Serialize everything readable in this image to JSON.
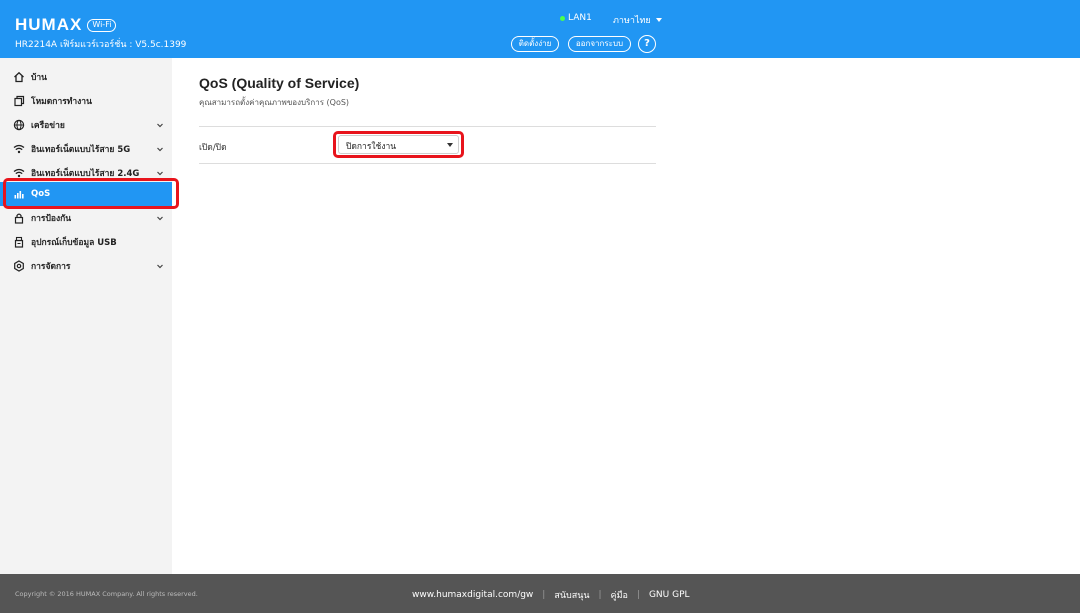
{
  "header": {
    "brand": "HUMAX",
    "brand_badge": "Wi-Fi",
    "firmware": "HR2214A เฟิร์มแวร์เวอร์ชั่น : V5.5c.1399",
    "lan_label": "LAN1",
    "language": "ภาษาไทย",
    "setup_button": "ติดตั้งง่าย",
    "logout_button": "ออกจากระบบ",
    "help_button": "?"
  },
  "sidebar": {
    "items": [
      {
        "label": "บ้าน",
        "icon": "home-icon"
      },
      {
        "label": "โหมดการทำงาน",
        "icon": "mode-icon"
      },
      {
        "label": "เครือข่าย",
        "icon": "globe-icon"
      },
      {
        "label": "อินเทอร์เน็ตแบบไร้สาย 5G",
        "icon": "wifi-icon"
      },
      {
        "label": "อินเทอร์เน็ตแบบไร้สาย 2.4G",
        "icon": "wifi-icon"
      },
      {
        "label": "QoS",
        "icon": "bar-chart-icon"
      },
      {
        "label": "การป้องกัน",
        "icon": "lock-icon"
      },
      {
        "label": "อุปกรณ์เก็บข้อมูล USB",
        "icon": "usb-icon"
      },
      {
        "label": "การจัดการ",
        "icon": "gear-icon"
      }
    ]
  },
  "main": {
    "title": "QoS (Quality of Service)",
    "subtitle": "คุณสามารถตั้งค่าคุณภาพของบริการ (QoS)",
    "toggle_label": "เปิด/ปิด",
    "toggle_value": "ปิดการใช้งาน"
  },
  "footer": {
    "copyright": "Copyright © 2016 HUMAX Company. All rights reserved.",
    "links": [
      "www.humaxdigital.com/gw",
      "สนับสนุน",
      "คู่มือ",
      "GNU GPL"
    ]
  },
  "colors": {
    "header_bg": "#2196f3",
    "active_bg": "#2196f3",
    "highlight": "#e8141c",
    "footer_bg": "#555555"
  }
}
